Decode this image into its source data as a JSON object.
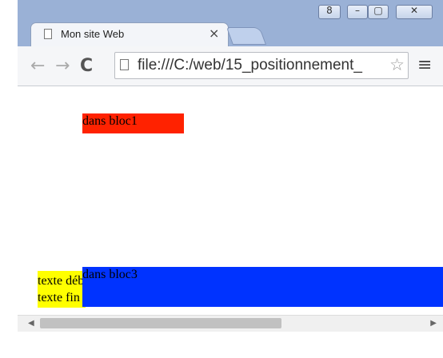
{
  "tab": {
    "title": "Mon site Web",
    "close": "×"
  },
  "window_controls": {
    "user": "8",
    "minimize": "–",
    "maximize": "▢",
    "close": "✕"
  },
  "toolbar": {
    "back": "←",
    "forward": "→",
    "reload": "C",
    "menu": "≡",
    "star": "☆"
  },
  "address": {
    "url": "file:///C:/web/15_positionnement_"
  },
  "content": {
    "bloc1": "dans bloc1",
    "bloc2_line1": "texte début",
    "bloc2_line2": "texte fin",
    "bloc3": "dans bloc3"
  },
  "scrollbar": {
    "left": "◀",
    "right": "▶"
  },
  "colors": {
    "bloc1": "#ff2200",
    "bloc2": "#ffff00",
    "bloc3": "#0033ff"
  }
}
